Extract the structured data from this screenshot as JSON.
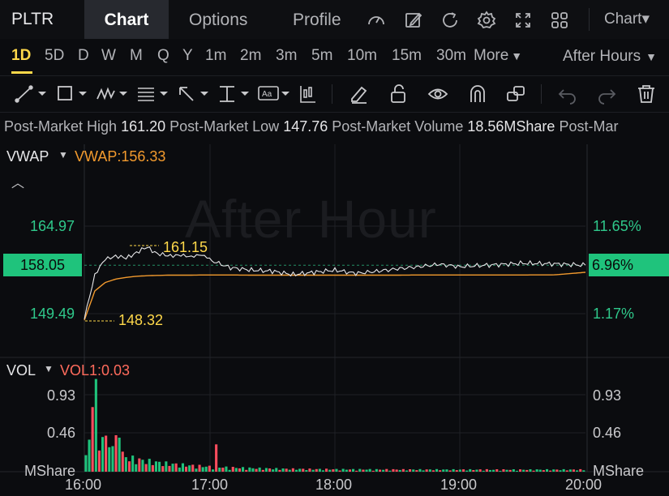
{
  "topbar": {
    "ticker": "PLTR",
    "tabs": [
      "Chart",
      "Options",
      "Profile"
    ],
    "active_tab": "Chart",
    "chart_type": "Chart▾",
    "icons": [
      "indicator-gauge-icon",
      "draw-pencil-icon",
      "refresh-icon",
      "settings-gear-icon",
      "fullscreen-icon",
      "layout-grid-icon"
    ]
  },
  "periods": {
    "items": [
      "1D",
      "5D",
      "D",
      "W",
      "M",
      "Q",
      "Y",
      "1m",
      "2m",
      "3m",
      "5m",
      "10m",
      "15m",
      "30m"
    ],
    "active": "1D",
    "more": "More",
    "session": "After Hours"
  },
  "toolbar": {
    "icons": [
      "trend-line-icon",
      "rectangle-icon",
      "pattern-icon",
      "fib-icon",
      "arrow-icon",
      "measure-icon",
      "text-icon",
      "candle-icon",
      "eraser-icon",
      "lock-icon",
      "eye-icon",
      "magnet-icon",
      "link-icon",
      "undo-icon",
      "redo-icon",
      "trash-icon"
    ]
  },
  "stats": {
    "high_label": "Post-Market High",
    "high_value": "161.20",
    "low_label": "Post-Market Low",
    "low_value": "147.76",
    "volume_label": "Post-Market Volume",
    "volume_value": "18.56MShare",
    "truncated_label": "Post-Mar"
  },
  "price_panel": {
    "indicator": "VWAP",
    "indicator_value": "VWAP:156.33",
    "watermark": "After Hour",
    "left_axis": [
      "164.97",
      "158.05",
      "149.49"
    ],
    "right_axis": [
      "11.65%",
      "6.96%",
      "1.17%"
    ],
    "current_price": "158.05",
    "current_pct": "6.96%",
    "high_annotation": "161.15",
    "low_annotation": "148.32"
  },
  "volume_panel": {
    "indicator": "VOL",
    "indicator_value": "VOL1:0.03",
    "left_axis": [
      "0.93",
      "0.46",
      "MShare"
    ],
    "right_axis": [
      "0.93",
      "0.46",
      "MShare"
    ]
  },
  "time_axis": [
    "16:00",
    "17:00",
    "18:00",
    "19:00",
    "20:00"
  ],
  "colors": {
    "up": "#1fc37c",
    "down": "#ff4d5e",
    "vwap": "#f29a2e",
    "accent": "#ffd84a",
    "price_line": "#e8e8ea"
  },
  "chart_data": {
    "type": "line",
    "x": [
      "16:00",
      "16:05",
      "16:10",
      "16:15",
      "16:20",
      "16:25",
      "16:30",
      "16:35",
      "16:40",
      "16:45",
      "16:50",
      "16:55",
      "17:00",
      "17:10",
      "17:20",
      "17:30",
      "17:40",
      "17:50",
      "18:00",
      "18:10",
      "18:20",
      "18:30",
      "18:40",
      "18:50",
      "19:00",
      "19:15",
      "19:30",
      "19:45",
      "20:00"
    ],
    "series": [
      {
        "name": "",
        "values": [
          148.5,
          156.5,
          159.0,
          159.8,
          159.2,
          160.4,
          161.15,
          160.2,
          159.6,
          160.0,
          159.4,
          160.1,
          159.0,
          157.6,
          157.2,
          157.0,
          156.4,
          156.8,
          157.2,
          156.6,
          157.0,
          157.4,
          157.8,
          158.2,
          157.8,
          158.1,
          158.4,
          158.3,
          158.05
        ]
      },
      {
        "name": "VWAP",
        "values": [
          148.32,
          153.5,
          155.0,
          155.6,
          155.9,
          156.1,
          156.2,
          156.25,
          156.3,
          156.3,
          156.3,
          156.32,
          156.33,
          156.33,
          156.3,
          156.3,
          156.3,
          156.3,
          156.3,
          156.3,
          156.3,
          156.3,
          156.33,
          156.33,
          156.33,
          156.33,
          156.33,
          156.35,
          156.8
        ]
      }
    ],
    "ylim": [
      147.0,
      166.0
    ],
    "grid": true
  }
}
